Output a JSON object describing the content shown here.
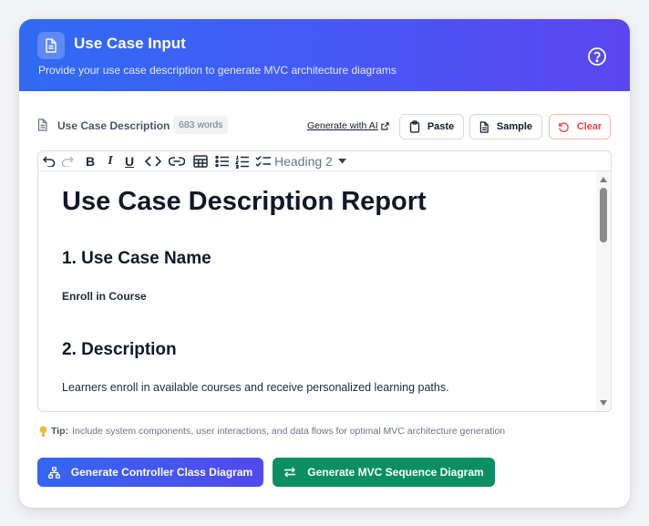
{
  "header": {
    "title": "Use Case Input",
    "subtitle": "Provide your use case description to generate MVC architecture diagrams",
    "icons": {
      "badge": "document-icon",
      "help": "help-circle-icon"
    }
  },
  "field": {
    "label": "Use Case Description",
    "word_count": "683 words",
    "ai_link": "Generate with AI",
    "buttons": {
      "paste": "Paste",
      "sample": "Sample",
      "clear": "Clear"
    }
  },
  "toolbar": {
    "heading_value": "Heading 2",
    "tools": [
      "undo-icon",
      "redo-icon",
      "bold-icon",
      "italic-icon",
      "underline-icon",
      "code-icon",
      "link-icon",
      "table-icon",
      "bullet-list-icon",
      "ordered-list-icon",
      "checklist-icon"
    ]
  },
  "editor": {
    "h1": "Use Case Description Report",
    "section1_heading": "1. Use Case Name",
    "section1_text": "Enroll in Course",
    "section2_heading": "2. Description",
    "section2_text": "Learners enroll in available courses and receive personalized learning paths."
  },
  "tip": {
    "label": "Tip:",
    "text": "Include system components, user interactions, and data flows for optimal MVC architecture generation"
  },
  "actions": {
    "controller": "Generate Controller Class Diagram",
    "sequence": "Generate MVC Sequence Diagram"
  },
  "colors": {
    "header_start": "#2f6bf3",
    "header_end": "#5b46f0",
    "danger": "#ef4444",
    "success": "#0a8f63"
  }
}
